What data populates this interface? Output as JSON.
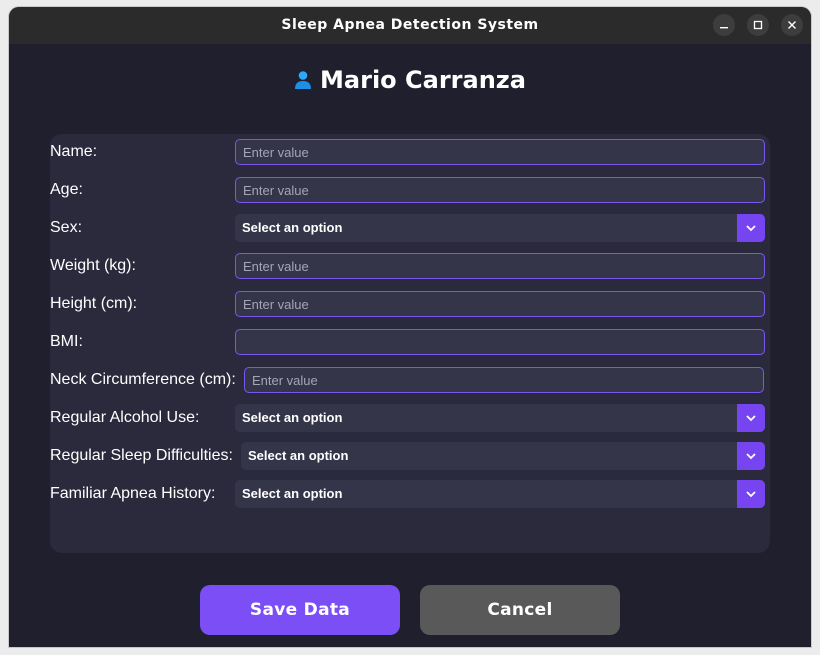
{
  "window": {
    "title": "Sleep Apnea Detection System"
  },
  "header": {
    "icon": "user-icon",
    "user_name": "Mario Carranza"
  },
  "form": {
    "fields": [
      {
        "label": "Name:",
        "type": "input",
        "value": "",
        "placeholder": "Enter value"
      },
      {
        "label": "Age:",
        "type": "input",
        "value": "",
        "placeholder": "Enter value"
      },
      {
        "label": "Sex:",
        "type": "select",
        "selected": "Select an option"
      },
      {
        "label": "Weight (kg):",
        "type": "input",
        "value": "",
        "placeholder": "Enter value"
      },
      {
        "label": "Height (cm):",
        "type": "input",
        "value": "",
        "placeholder": "Enter value"
      },
      {
        "label": "BMI:",
        "type": "input",
        "value": "",
        "placeholder": ""
      },
      {
        "label": "Neck Circumference (cm):",
        "type": "input",
        "value": "",
        "placeholder": "Enter value"
      },
      {
        "label": "Regular Alcohol Use:",
        "type": "select",
        "selected": "Select an option"
      },
      {
        "label": "Regular Sleep Difficulties:",
        "type": "select",
        "selected": "Select an option"
      },
      {
        "label": "Familiar Apnea History:",
        "type": "select",
        "selected": "Select an option"
      }
    ]
  },
  "buttons": {
    "save_label": "Save Data",
    "cancel_label": "Cancel"
  },
  "colors": {
    "accent": "#7b4ff5",
    "background": "#1f1f2e",
    "panel": "#2a2a3c",
    "cancel": "#595959"
  }
}
